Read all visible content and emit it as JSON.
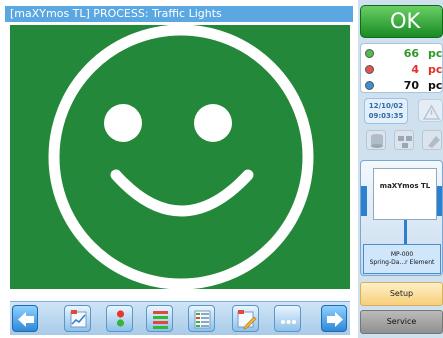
{
  "header": {
    "title": "[maXYmos TL] PROCESS: Traffic Lights"
  },
  "display": {
    "face": "smiley-icon",
    "background": "#24883a"
  },
  "toolbar": {
    "buttons": [
      {
        "name": "previous-arrow-button",
        "icon": "left-arrow-icon"
      },
      {
        "name": "graph-view-button",
        "icon": "curve-chart-icon"
      },
      {
        "name": "traffic-light-button",
        "icon": "traffic-light-icon"
      },
      {
        "name": "bar-list-button",
        "icon": "bar-list-icon"
      },
      {
        "name": "table-view-button",
        "icon": "table-icon"
      },
      {
        "name": "edit-view-button",
        "icon": "pencil-chart-icon"
      },
      {
        "name": "more-button",
        "icon": "ellipsis-icon"
      },
      {
        "name": "next-arrow-button",
        "icon": "right-arrow-icon"
      }
    ]
  },
  "status": {
    "ok_label": "OK",
    "ok_color": "#198a24"
  },
  "counts": [
    {
      "value": "66",
      "unit": "pcs",
      "color": "#2f9a2b",
      "dot": "#4cc04a"
    },
    {
      "value": "4",
      "unit": "pcs",
      "color": "#e0302a",
      "dot": "#e65252"
    },
    {
      "value": "70",
      "unit": "pcs",
      "color": "#111111",
      "dot": "#3f8fd4"
    }
  ],
  "datetime": {
    "date": "12/10/02",
    "time": "09:03:35"
  },
  "process": {
    "title": "maXYmos TL",
    "element_id": "MP-000",
    "element_name": "Spring-Da...r Element"
  },
  "buttons": {
    "setup": "Setup",
    "service": "Service"
  }
}
